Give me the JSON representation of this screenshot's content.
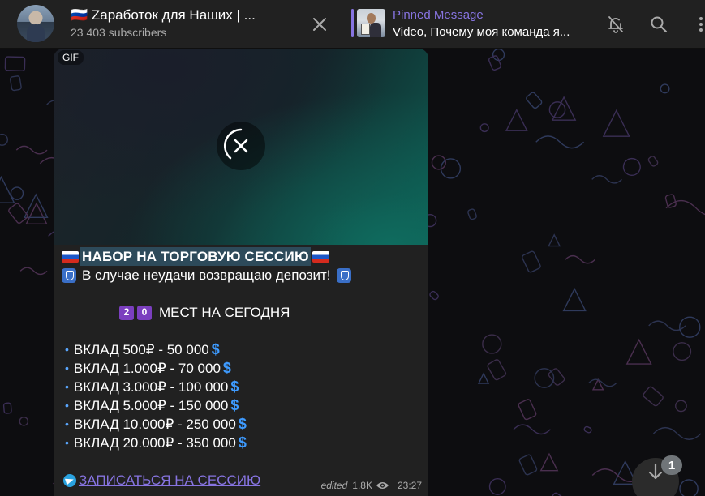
{
  "header": {
    "title": "🇷🇺 Zаработок для Наших | ...",
    "subscribers": "23 403 subscribers",
    "pinned_label": "Pinned Message",
    "pinned_text": "Video, Почему моя команда я..."
  },
  "message": {
    "media_badge": "GIF",
    "headline": "НАБОР НА ТОРГОВУЮ СЕССИЮ",
    "deposit_line": "В случае неудачи возвращаю депозит!",
    "seats_digits": [
      "2",
      "0"
    ],
    "seats_text": "МЕСТ НА СЕГОДНЯ",
    "deposits": [
      "ВКЛАД 500₽ - 50 000",
      "ВКЛАД 1.000₽ - 70 000",
      "ВКЛАД 3.000₽ - 100 000",
      "ВКЛАД 5.000₽ - 150 000",
      "ВКЛАД 10.000₽ - 250 000",
      "ВКЛАД 20.000₽ - 350 000"
    ],
    "link_text": "ЗАПИСАТЬСЯ НА СЕССИЮ",
    "edited": "edited",
    "views": "1.8K",
    "time": "23:27"
  },
  "scroll": {
    "unread_count": "1"
  },
  "icons": {
    "close": "close-icon",
    "mute": "bell-off-icon",
    "search": "search-icon",
    "more": "more-vertical-icon",
    "views": "eye-icon",
    "scroll": "arrow-down-icon"
  },
  "colors": {
    "accent": "#8774e1",
    "header_bg": "#212121",
    "bubble_bg": "#212121"
  }
}
